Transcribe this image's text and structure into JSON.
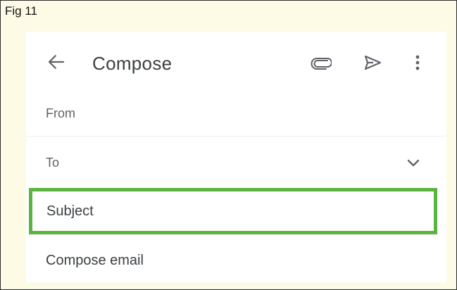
{
  "figure": {
    "label": "Fig 11"
  },
  "compose": {
    "title": "Compose",
    "icons": {
      "back": "arrow-back-icon",
      "attach": "paperclip-icon",
      "send": "send-icon",
      "more": "more-vert-icon",
      "expand": "chevron-down-icon"
    },
    "fields": {
      "from_label": "From",
      "to_label": "To",
      "subject_label": "Subject",
      "body_label": "Compose email"
    },
    "highlight_color": "#5db33f"
  }
}
